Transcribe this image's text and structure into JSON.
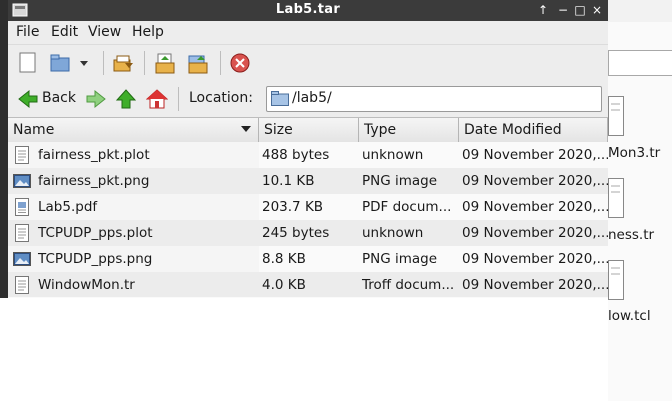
{
  "window": {
    "title": "Lab5.tar"
  },
  "titlebar_buttons": {
    "up": "↑",
    "minimize": "−",
    "maximize": "□",
    "close": "×"
  },
  "menu": [
    "File",
    "Edit",
    "View",
    "Help"
  ],
  "nav": {
    "back_label": "Back",
    "location_label": "Location:",
    "location_value": "/lab5/"
  },
  "columns": [
    "Name",
    "Size",
    "Type",
    "Date Modified"
  ],
  "files": [
    {
      "name": "fairness_pkt.plot",
      "size": "488 bytes",
      "type": "unknown",
      "date": "09 November 2020,...",
      "icon": "text-file-icon"
    },
    {
      "name": "fairness_pkt.png",
      "size": "10.1 KB",
      "type": "PNG image",
      "date": "09 November 2020,...",
      "icon": "image-file-icon"
    },
    {
      "name": "Lab5.pdf",
      "size": "203.7 KB",
      "type": "PDF docum...",
      "date": "09 November 2020,...",
      "icon": "pdf-file-icon"
    },
    {
      "name": "TCPUDP_pps.plot",
      "size": "245 bytes",
      "type": "unknown",
      "date": "09 November 2020,...",
      "icon": "text-file-icon"
    },
    {
      "name": "TCPUDP_pps.png",
      "size": "8.8 KB",
      "type": "PNG image",
      "date": "09 November 2020,...",
      "icon": "image-file-icon"
    },
    {
      "name": "WindowMon.tr",
      "size": "4.0 KB",
      "type": "Troff docum...",
      "date": "09 November 2020,...",
      "icon": "text-file-icon"
    }
  ],
  "background_files": [
    "Mon3.tr",
    "ness.tr",
    "low.tcl"
  ]
}
